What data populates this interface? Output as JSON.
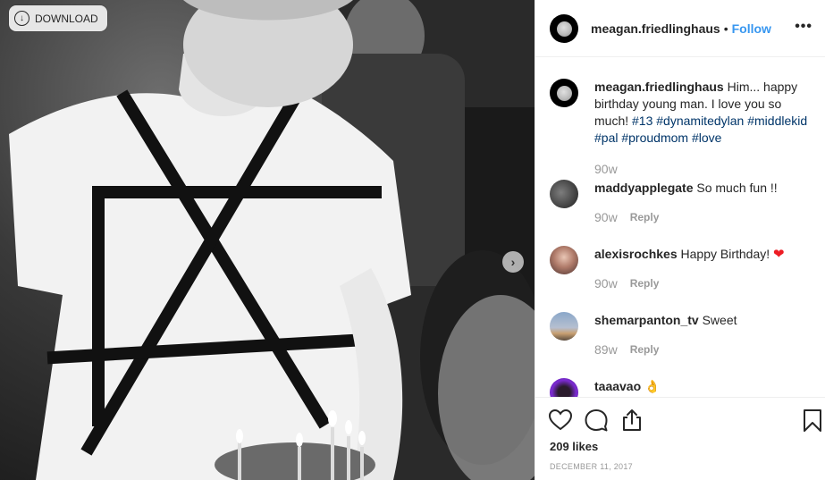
{
  "photo": {
    "download_label": "DOWNLOAD",
    "download_icon": "download-circle-icon",
    "next_icon": "chevron-right-icon"
  },
  "post": {
    "author": "meagan.friedlinghaus",
    "separator": "•",
    "follow_label": "Follow",
    "more_label": "•••"
  },
  "comments": [
    {
      "user": "meagan.friedlinghaus",
      "text_prefix": "Him... happy birthday young man. I love you so much! ",
      "hashtags": [
        "#13",
        "#dynamitedylan",
        "#middlekid",
        "#pal",
        "#proudmom",
        "#love"
      ],
      "time": "90w",
      "avatar": "moon"
    },
    {
      "user": "maddyapplegate",
      "text": "So much fun !!",
      "time": "90w",
      "reply": "Reply",
      "avatar": "gray"
    },
    {
      "user": "alexisrochkes",
      "text": "Happy Birthday!",
      "emoji": "❤",
      "time": "90w",
      "reply": "Reply",
      "avatar": "girl"
    },
    {
      "user": "shemarpanton_tv",
      "text": "Sweet",
      "time": "89w",
      "reply": "Reply",
      "avatar": "tower"
    },
    {
      "user": "taaavao",
      "emoji": "👌",
      "avatar": "purple"
    }
  ],
  "actions": {
    "like_icon": "heart-outline-icon",
    "comment_icon": "comment-bubble-icon",
    "share_icon": "share-upload-icon",
    "save_icon": "bookmark-icon"
  },
  "likes_text": "209 likes",
  "date_text": "DECEMBER 11, 2017",
  "colors": {
    "link": "#3897f0",
    "hashtag": "#003569",
    "muted": "#999999",
    "text": "#262626",
    "heart": "#ed1c24"
  }
}
